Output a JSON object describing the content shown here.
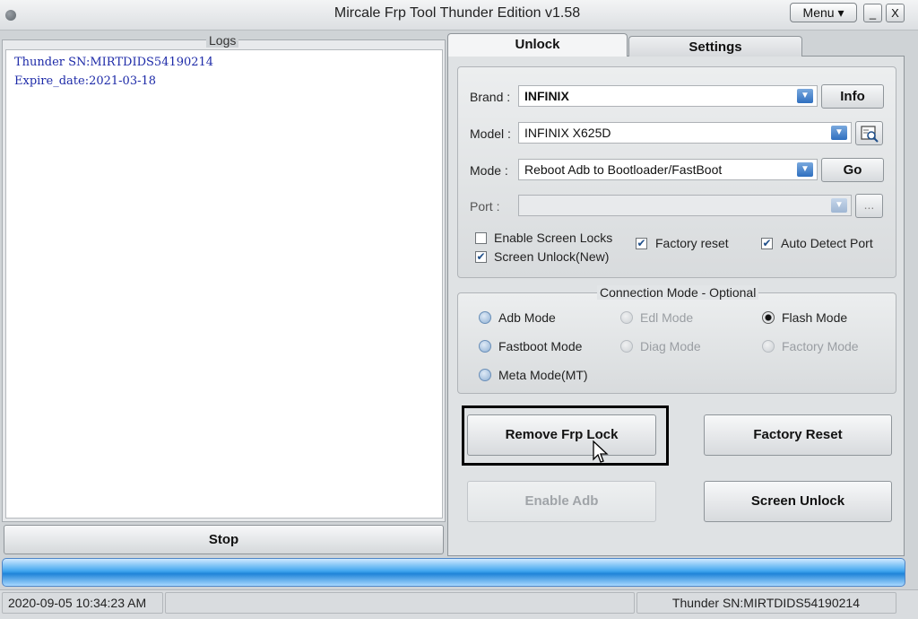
{
  "window": {
    "title": "Mircale Frp Tool Thunder Edition v1.58",
    "menu_label": "Menu ▾",
    "minimize_label": "_",
    "close_label": "X"
  },
  "logs": {
    "caption": "Logs",
    "lines": [
      "Thunder SN:MIRTDIDS54190214",
      "Expire_date:2021-03-18"
    ],
    "stop_label": "Stop"
  },
  "tabs": [
    "Unlock",
    "Settings"
  ],
  "unlock": {
    "brand_label": "Brand :",
    "brand_value": "INFINIX",
    "info_label": "Info",
    "model_label": "Model :",
    "model_value": "INFINIX X625D",
    "mode_label": "Mode :",
    "mode_value": "Reboot Adb to Bootloader/FastBoot",
    "go_label": "Go",
    "port_label": "Port :",
    "port_value": "",
    "browse_label": "...",
    "checkboxes": [
      {
        "label": "Enable Screen Locks",
        "checked": false
      },
      {
        "label": "Screen Unlock(New)",
        "checked": true
      },
      {
        "label": "Factory reset",
        "checked": true
      },
      {
        "label": "Auto Detect Port",
        "checked": true
      }
    ]
  },
  "connection": {
    "caption": "Connection Mode - Optional",
    "modes": [
      {
        "label": "Adb Mode",
        "enabled": true,
        "checked": false
      },
      {
        "label": "Edl Mode",
        "enabled": false,
        "checked": false
      },
      {
        "label": "Flash Mode",
        "enabled": true,
        "checked": true
      },
      {
        "label": "Fastboot Mode",
        "enabled": true,
        "checked": false
      },
      {
        "label": "Diag Mode",
        "enabled": false,
        "checked": false
      },
      {
        "label": "Factory Mode",
        "enabled": false,
        "checked": false
      },
      {
        "label": "Meta Mode(MT)",
        "enabled": true,
        "checked": false
      }
    ]
  },
  "actions": {
    "remove_frp": "Remove Frp Lock",
    "factory_reset": "Factory Reset",
    "enable_adb": "Enable Adb",
    "screen_unlock": "Screen Unlock"
  },
  "progress": {
    "value": 1.0
  },
  "status": {
    "datetime": "2020-09-05 10:34:23 AM",
    "serial": "Thunder SN:MIRTDIDS54190214"
  },
  "colors": {
    "accent": "#2f86da",
    "log_text": "#1d2aa8"
  }
}
